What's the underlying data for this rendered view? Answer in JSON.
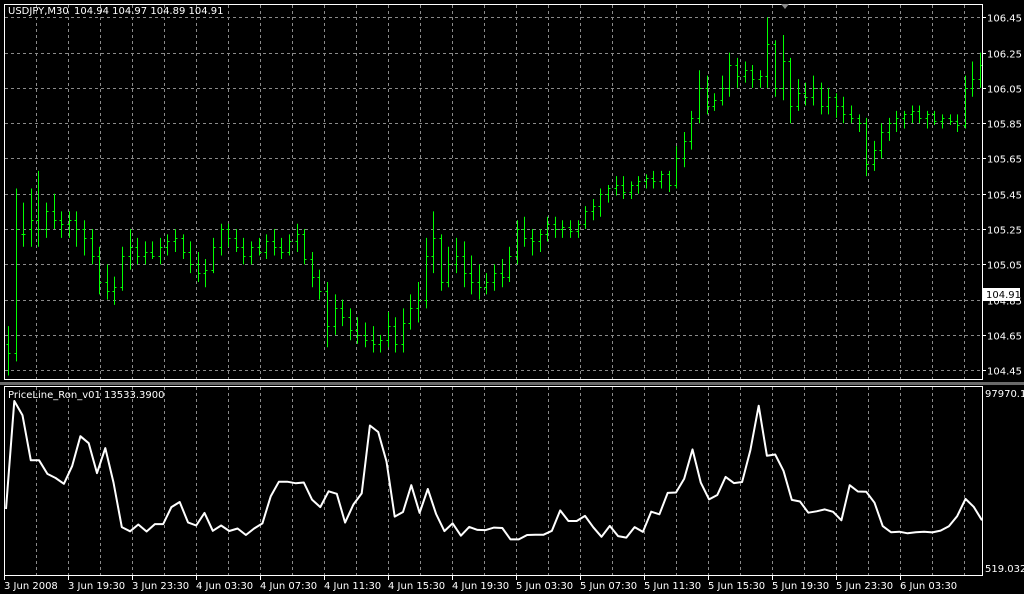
{
  "main_pane": {
    "symbol_label": "USDJPY,M30",
    "ohlc_label": "104.94 104.97 104.89 104.91",
    "price_axis_ticks": [
      "106.45",
      "106.25",
      "106.05",
      "105.85",
      "105.65",
      "105.45",
      "105.25",
      "105.05",
      "104.85",
      "104.65",
      "104.45"
    ],
    "current_price_tag": "104.91",
    "bar_color": "#00ff00"
  },
  "indicator_pane": {
    "title": "PriceLine_Ron_v01 13533.3900",
    "axis_top": "97970.17",
    "axis_bottom": "519.0325",
    "line_color": "#ffffff"
  },
  "time_axis": {
    "labels": [
      "3 Jun 2008",
      "3 Jun 19:30",
      "3 Jun 23:30",
      "4 Jun 03:30",
      "4 Jun 07:30",
      "4 Jun 11:30",
      "4 Jun 15:30",
      "4 Jun 19:30",
      "5 Jun 03:30",
      "5 Jun 07:30",
      "5 Jun 11:30",
      "5 Jun 15:30",
      "5 Jun 19:30",
      "5 Jun 23:30",
      "6 Jun 03:30"
    ]
  },
  "chart_data": [
    {
      "type": "candlestick",
      "title": "USDJPY,M30",
      "ylim": [
        104.4,
        106.52
      ],
      "grid": true,
      "bars": [
        [
          104.6,
          104.7,
          104.42,
          104.55
        ],
        [
          104.55,
          105.48,
          104.5,
          105.25
        ],
        [
          105.22,
          105.4,
          105.15,
          105.22
        ],
        [
          105.25,
          105.48,
          105.15,
          105.3
        ],
        [
          105.3,
          105.58,
          105.15,
          105.25
        ],
        [
          105.25,
          105.4,
          105.2,
          105.35
        ],
        [
          105.35,
          105.45,
          105.25,
          105.3
        ],
        [
          105.3,
          105.35,
          105.2,
          105.28
        ],
        [
          105.28,
          105.35,
          105.2,
          105.3
        ],
        [
          105.3,
          105.35,
          105.15,
          105.25
        ],
        [
          105.25,
          105.3,
          105.1,
          105.2
        ],
        [
          105.2,
          105.25,
          105.05,
          105.1
        ],
        [
          105.1,
          105.15,
          104.88,
          104.95
        ],
        [
          104.95,
          105.05,
          104.85,
          104.9
        ],
        [
          104.9,
          104.98,
          104.82,
          104.92
        ],
        [
          104.92,
          105.15,
          104.9,
          105.1
        ],
        [
          105.1,
          105.25,
          105.02,
          105.15
        ],
        [
          105.15,
          105.2,
          105.05,
          105.1
        ],
        [
          105.1,
          105.18,
          105.05,
          105.12
        ],
        [
          105.12,
          105.18,
          105.08,
          105.1
        ],
        [
          105.1,
          105.2,
          105.05,
          105.15
        ],
        [
          105.15,
          105.22,
          105.1,
          105.18
        ],
        [
          105.18,
          105.25,
          105.12,
          105.2
        ],
        [
          105.2,
          105.22,
          105.08,
          105.12
        ],
        [
          105.12,
          105.18,
          105.0,
          105.05
        ],
        [
          105.05,
          105.12,
          104.95,
          105.0
        ],
        [
          105.0,
          105.08,
          104.92,
          105.02
        ],
        [
          105.02,
          105.2,
          105.0,
          105.15
        ],
        [
          105.15,
          105.28,
          105.1,
          105.25
        ],
        [
          105.25,
          105.28,
          105.15,
          105.2
        ],
        [
          105.2,
          105.25,
          105.12,
          105.15
        ],
        [
          105.15,
          105.2,
          105.05,
          105.1
        ],
        [
          105.1,
          105.18,
          105.05,
          105.15
        ],
        [
          105.15,
          105.2,
          105.1,
          105.12
        ],
        [
          105.12,
          105.22,
          105.08,
          105.18
        ],
        [
          105.18,
          105.25,
          105.1,
          105.15
        ],
        [
          105.15,
          105.2,
          105.08,
          105.12
        ],
        [
          105.12,
          105.22,
          105.1,
          105.18
        ],
        [
          105.18,
          105.28,
          105.12,
          105.22
        ],
        [
          105.22,
          105.25,
          105.05,
          105.08
        ],
        [
          105.08,
          105.12,
          104.92,
          104.98
        ],
        [
          104.98,
          105.02,
          104.85,
          104.9
        ],
        [
          104.9,
          104.95,
          104.58,
          104.7
        ],
        [
          104.7,
          104.88,
          104.65,
          104.8
        ],
        [
          104.8,
          104.85,
          104.7,
          104.75
        ],
        [
          104.75,
          104.8,
          104.62,
          104.68
        ],
        [
          104.68,
          104.75,
          104.6,
          104.65
        ],
        [
          104.65,
          104.72,
          104.58,
          104.62
        ],
        [
          104.62,
          104.7,
          104.55,
          104.6
        ],
        [
          104.6,
          104.65,
          104.55,
          104.62
        ],
        [
          104.62,
          104.78,
          104.58,
          104.7
        ],
        [
          104.7,
          104.75,
          104.55,
          104.6
        ],
        [
          104.6,
          104.8,
          104.55,
          104.72
        ],
        [
          104.72,
          104.88,
          104.68,
          104.8
        ],
        [
          104.8,
          104.95,
          104.72,
          104.85
        ],
        [
          104.85,
          105.2,
          104.8,
          105.1
        ],
        [
          105.1,
          105.35,
          105.0,
          105.2
        ],
        [
          105.2,
          105.22,
          104.9,
          104.95
        ],
        [
          104.95,
          105.15,
          104.92,
          105.05
        ],
        [
          105.05,
          105.2,
          105.0,
          105.1
        ],
        [
          105.1,
          105.18,
          104.92,
          105.0
        ],
        [
          105.0,
          105.1,
          104.88,
          104.95
        ],
        [
          104.95,
          105.05,
          104.85,
          104.92
        ],
        [
          104.92,
          105.0,
          104.88,
          104.95
        ],
        [
          104.95,
          105.05,
          104.9,
          105.0
        ],
        [
          105.0,
          105.08,
          104.92,
          104.98
        ],
        [
          104.98,
          105.15,
          104.95,
          105.1
        ],
        [
          105.1,
          105.3,
          105.05,
          105.25
        ],
        [
          105.25,
          105.32,
          105.15,
          105.2
        ],
        [
          105.2,
          105.25,
          105.1,
          105.18
        ],
        [
          105.18,
          105.25,
          105.12,
          105.22
        ],
        [
          105.22,
          105.32,
          105.18,
          105.28
        ],
        [
          105.28,
          105.32,
          105.2,
          105.25
        ],
        [
          105.25,
          105.3,
          105.2,
          105.26
        ],
        [
          105.26,
          105.3,
          105.2,
          105.24
        ],
        [
          105.24,
          105.3,
          105.2,
          105.28
        ],
        [
          105.28,
          105.38,
          105.25,
          105.35
        ],
        [
          105.35,
          105.42,
          105.3,
          105.38
        ],
        [
          105.38,
          105.48,
          105.32,
          105.45
        ],
        [
          105.45,
          105.5,
          105.4,
          105.48
        ],
        [
          105.48,
          105.55,
          105.44,
          105.5
        ],
        [
          105.5,
          105.55,
          105.42,
          105.46
        ],
        [
          105.46,
          105.52,
          105.42,
          105.5
        ],
        [
          105.5,
          105.55,
          105.45,
          105.52
        ],
        [
          105.52,
          105.56,
          105.48,
          105.54
        ],
        [
          105.54,
          105.58,
          105.48,
          105.52
        ],
        [
          105.52,
          105.58,
          105.48,
          105.56
        ],
        [
          105.56,
          105.58,
          105.46,
          105.5
        ],
        [
          105.5,
          105.72,
          105.48,
          105.65
        ],
        [
          105.65,
          105.8,
          105.6,
          105.75
        ],
        [
          105.75,
          105.92,
          105.7,
          105.88
        ],
        [
          105.88,
          106.15,
          105.85,
          106.05
        ],
        [
          106.05,
          106.12,
          105.9,
          105.95
        ],
        [
          105.95,
          106.02,
          105.92,
          105.98
        ],
        [
          105.98,
          106.12,
          105.95,
          106.05
        ],
        [
          106.05,
          106.25,
          106.0,
          106.18
        ],
        [
          106.18,
          106.22,
          106.05,
          106.12
        ],
        [
          106.12,
          106.2,
          106.08,
          106.15
        ],
        [
          106.15,
          106.18,
          106.05,
          106.1
        ],
        [
          106.1,
          106.15,
          106.05,
          106.12
        ],
        [
          106.12,
          106.45,
          106.05,
          106.3
        ],
        [
          106.3,
          106.32,
          106.0,
          106.05
        ],
        [
          106.05,
          106.35,
          105.98,
          106.2
        ],
        [
          106.2,
          106.22,
          105.85,
          105.95
        ],
        [
          105.95,
          106.1,
          105.92,
          106.02
        ],
        [
          106.02,
          106.08,
          105.95,
          106.0
        ],
        [
          106.0,
          106.12,
          105.95,
          106.05
        ],
        [
          106.05,
          106.08,
          105.9,
          105.95
        ],
        [
          105.95,
          106.05,
          105.9,
          106.0
        ],
        [
          106.0,
          106.02,
          105.88,
          105.95
        ],
        [
          105.95,
          106.0,
          105.85,
          105.9
        ],
        [
          105.9,
          105.95,
          105.85,
          105.88
        ],
        [
          105.88,
          105.9,
          105.8,
          105.85
        ],
        [
          105.85,
          105.88,
          105.55,
          105.62
        ],
        [
          105.62,
          105.75,
          105.58,
          105.7
        ],
        [
          105.7,
          105.85,
          105.65,
          105.8
        ],
        [
          105.8,
          105.88,
          105.75,
          105.85
        ],
        [
          105.85,
          105.92,
          105.8,
          105.88
        ],
        [
          105.88,
          105.92,
          105.82,
          105.9
        ],
        [
          105.9,
          105.95,
          105.85,
          105.92
        ],
        [
          105.92,
          105.95,
          105.85,
          105.88
        ],
        [
          105.88,
          105.92,
          105.82,
          105.9
        ],
        [
          105.9,
          105.92,
          105.84,
          105.86
        ],
        [
          105.86,
          105.9,
          105.82,
          105.88
        ],
        [
          105.88,
          105.9,
          105.84,
          105.86
        ],
        [
          105.86,
          105.9,
          105.8,
          105.84
        ],
        [
          105.84,
          106.12,
          105.82,
          106.05
        ],
        [
          106.05,
          106.2,
          106.0,
          106.1
        ],
        [
          106.1,
          106.25,
          106.05,
          106.18
        ]
      ]
    },
    {
      "type": "line",
      "title": "PriceLine_Ron_v01 13533.3900",
      "ylim": [
        519.0325,
        97970.17
      ],
      "series": [
        {
          "name": "PriceLine_Ron_v01",
          "values": [
            36400,
            97970,
            89800,
            64200,
            64200,
            56400,
            54100,
            50800,
            61000,
            77900,
            73900,
            56900,
            71100,
            51500,
            26100,
            23700,
            27600,
            23600,
            27800,
            27800,
            37500,
            40400,
            28800,
            27000,
            34200,
            24000,
            27000,
            23900,
            25300,
            21600,
            25300,
            28200,
            43600,
            52000,
            52000,
            51100,
            51500,
            41800,
            37500,
            46500,
            45100,
            28700,
            39000,
            45300,
            84000,
            80300,
            63500,
            32100,
            34700,
            50000,
            34200,
            47800,
            33600,
            23800,
            28300,
            21200,
            26200,
            24500,
            24400,
            25800,
            25600,
            19100,
            19100,
            21600,
            21800,
            21800,
            24000,
            35600,
            29600,
            29600,
            32500,
            26000,
            20600,
            26800,
            21000,
            20100,
            26100,
            23400,
            34900,
            33400,
            45600,
            45800,
            53700,
            70400,
            51400,
            41900,
            44400,
            54700,
            51200,
            51800,
            70000,
            95300,
            66800,
            67500,
            58200,
            41600,
            40700,
            34300,
            35100,
            36200,
            34800,
            30000,
            50000,
            46400,
            46300,
            40000,
            26700,
            23200,
            23500,
            22600,
            23200,
            23500,
            23100,
            24100,
            26600,
            32400,
            42200,
            37700,
            30000
          ]
        }
      ]
    }
  ]
}
